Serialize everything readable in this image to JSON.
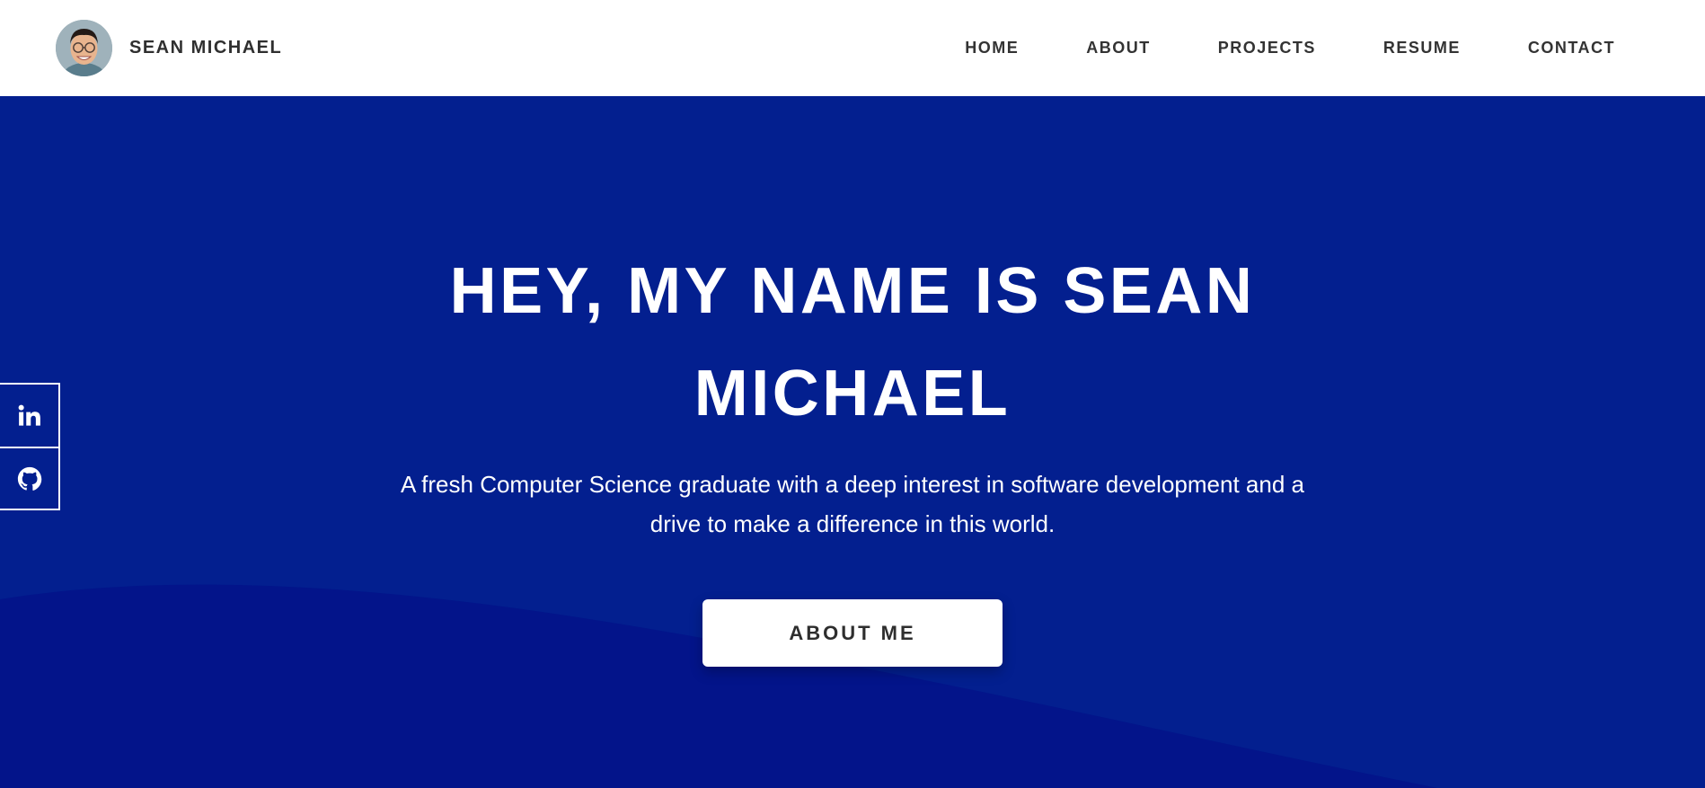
{
  "header": {
    "brand_name": "SEAN MICHAEL",
    "avatar_icon": "profile-photo",
    "nav": [
      {
        "label": "HOME"
      },
      {
        "label": "ABOUT"
      },
      {
        "label": "PROJECTS"
      },
      {
        "label": "RESUME"
      },
      {
        "label": "CONTACT"
      }
    ]
  },
  "hero": {
    "title": "HEY, MY NAME IS SEAN MICHAEL",
    "subtitle": "A fresh Computer Science graduate with a deep interest in software development and a drive to make a difference in this world.",
    "cta_label": "ABOUT ME",
    "colors": {
      "wave_dark": "#03148a",
      "wave_light": "#00b2c6",
      "button_bg": "#ffffff",
      "button_text": "#2e2e2e"
    }
  },
  "social": {
    "items": [
      {
        "icon": "linkedin-icon"
      },
      {
        "icon": "github-icon"
      }
    ]
  }
}
